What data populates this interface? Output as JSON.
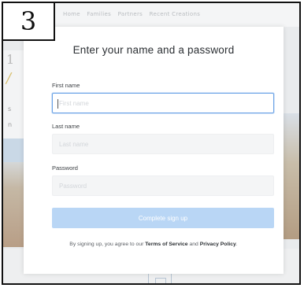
{
  "step": "3",
  "background": {
    "nav": [
      "Home",
      "Families",
      "Partners",
      "Recent Creations"
    ]
  },
  "modal": {
    "title": "Enter your name and a password",
    "first_name": {
      "label": "First name",
      "placeholder": "First name",
      "value": ""
    },
    "last_name": {
      "label": "Last name",
      "placeholder": "Last name",
      "value": ""
    },
    "password": {
      "label": "Password",
      "placeholder": "Password",
      "value": ""
    },
    "submit_label": "Complete sign up",
    "terms": {
      "prefix": "By signing up, you agree to our ",
      "tos": "Terms of Service",
      "and": " and ",
      "privacy": "Privacy Policy",
      "suffix": "."
    }
  },
  "colors": {
    "focus_border": "#6aa2e6",
    "button_disabled": "#b9d6f5",
    "field_bg": "#f4f5f6"
  }
}
